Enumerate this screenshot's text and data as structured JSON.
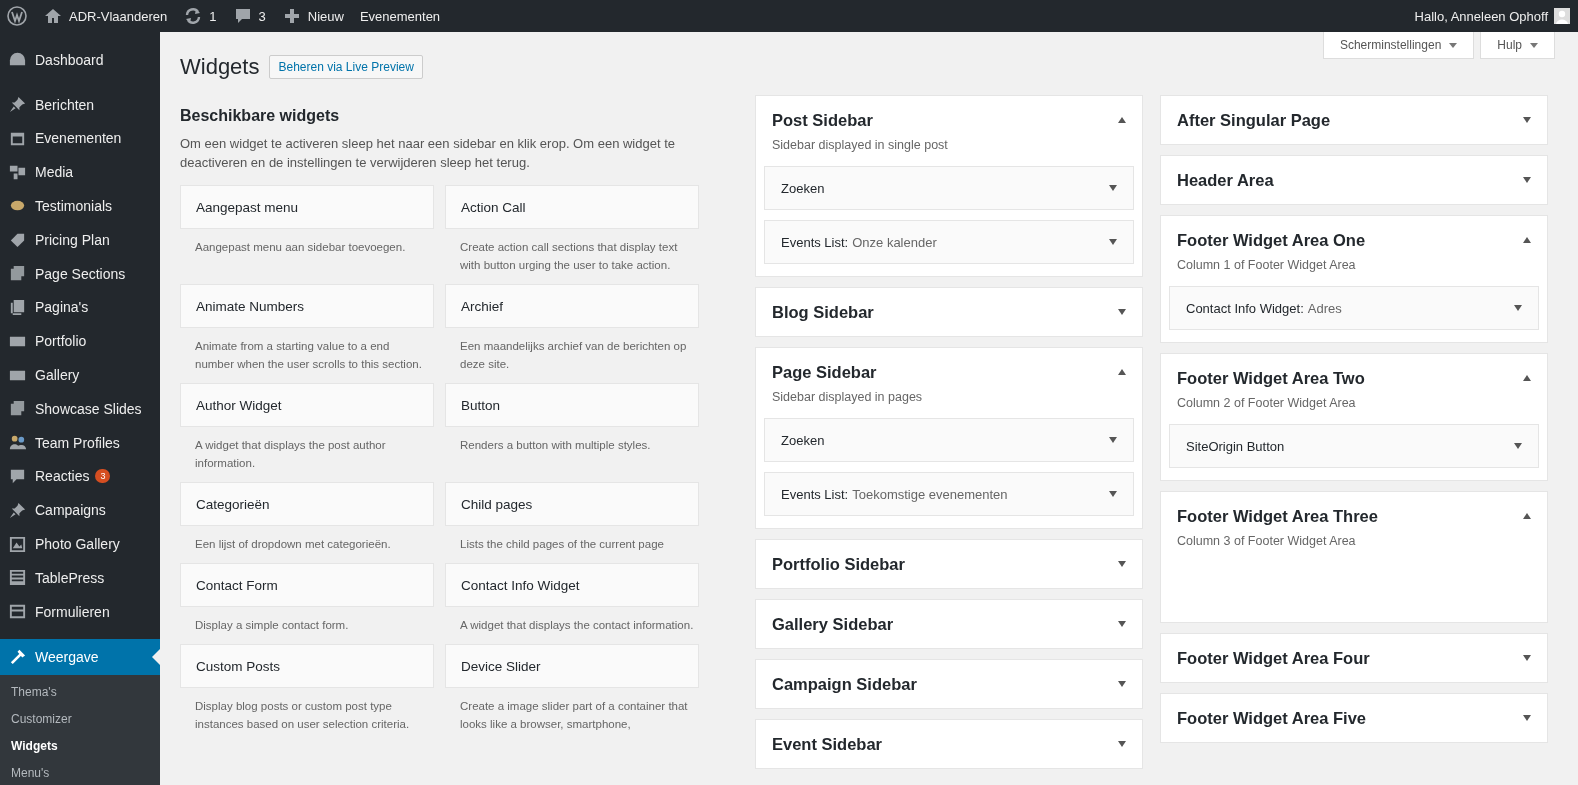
{
  "admin_bar": {
    "site": "ADR-Vlaanderen",
    "updates": "1",
    "comments": "3",
    "new": "Nieuw",
    "extra": "Evenementen",
    "greeting": "Hallo, Anneleen Ophoff"
  },
  "menu": [
    {
      "label": "Dashboard",
      "selected": false
    },
    {
      "label": "Berichten",
      "selected": false
    },
    {
      "label": "Evenementen",
      "selected": false
    },
    {
      "label": "Media",
      "selected": false
    },
    {
      "label": "Testimonials",
      "selected": false
    },
    {
      "label": "Pricing Plan",
      "selected": false
    },
    {
      "label": "Page Sections",
      "selected": false
    },
    {
      "label": "Pagina's",
      "selected": false
    },
    {
      "label": "Portfolio",
      "selected": false
    },
    {
      "label": "Gallery",
      "selected": false
    },
    {
      "label": "Showcase Slides",
      "selected": false
    },
    {
      "label": "Team Profiles",
      "selected": false
    },
    {
      "label": "Reacties",
      "selected": false,
      "badge": "3"
    },
    {
      "label": "Campaigns",
      "selected": false
    },
    {
      "label": "Photo Gallery",
      "selected": false
    },
    {
      "label": "TablePress",
      "selected": false
    },
    {
      "label": "Formulieren",
      "selected": false
    },
    {
      "label": "Weergave",
      "selected": true,
      "children": [
        {
          "label": "Thema's",
          "selected": false
        },
        {
          "label": "Customizer",
          "selected": false
        },
        {
          "label": "Widgets",
          "selected": true
        },
        {
          "label": "Menu's",
          "selected": false
        }
      ]
    }
  ],
  "screen_tabs": [
    "Scherminstellingen",
    "Hulp"
  ],
  "page": {
    "title": "Widgets",
    "action": "Beheren via Live Preview"
  },
  "available": {
    "heading": "Beschikbare widgets",
    "intro": "Om een widget te activeren sleep het naar een sidebar en klik erop. Om een widget te deactiveren en de instellingen te verwijderen sleep het terug.",
    "widgets": [
      {
        "title": "Aangepast menu",
        "description": "Aangepast menu aan sidebar toevoegen."
      },
      {
        "title": "Action Call",
        "description": "Create action call sections that display text with button urging the user to take action."
      },
      {
        "title": "Animate Numbers",
        "description": "Animate from a starting value to a end number when the user scrolls to this section."
      },
      {
        "title": "Archief",
        "description": "Een maandelijks archief van de berichten op deze site."
      },
      {
        "title": "Author Widget",
        "description": "A widget that displays the post author information."
      },
      {
        "title": "Button",
        "description": "Renders a button with multiple styles."
      },
      {
        "title": "Categorieën",
        "description": "Een lijst of dropdown met categorieën."
      },
      {
        "title": "Child pages",
        "description": "Lists the child pages of the current page"
      },
      {
        "title": "Contact Form",
        "description": "Display a simple contact form."
      },
      {
        "title": "Contact Info Widget",
        "description": "A widget that displays the contact information."
      },
      {
        "title": "Custom Posts",
        "description": "Display blog posts or custom post type instances based on user selection criteria."
      },
      {
        "title": "Device Slider",
        "description": "Create a image slider part of a container that looks like a browser, smartphone,"
      }
    ]
  },
  "sidebar_columns": [
    [
      {
        "title": "Post Sidebar",
        "expanded": true,
        "description": "Sidebar displayed in single post",
        "widgets": [
          {
            "title": "Zoeken"
          },
          {
            "title": "Events List:",
            "subtitle": "Onze kalender"
          }
        ]
      },
      {
        "title": "Blog Sidebar",
        "expanded": false
      },
      {
        "title": "Page Sidebar",
        "expanded": true,
        "description": "Sidebar displayed in pages",
        "widgets": [
          {
            "title": "Zoeken"
          },
          {
            "title": "Events List:",
            "subtitle": "Toekomstige evenementen"
          }
        ]
      },
      {
        "title": "Portfolio Sidebar",
        "expanded": false
      },
      {
        "title": "Gallery Sidebar",
        "expanded": false
      },
      {
        "title": "Campaign Sidebar",
        "expanded": false
      },
      {
        "title": "Event Sidebar",
        "expanded": false
      }
    ],
    [
      {
        "title": "After Singular Page",
        "expanded": false
      },
      {
        "title": "Header Area",
        "expanded": false
      },
      {
        "title": "Footer Widget Area One",
        "expanded": true,
        "description": "Column 1 of Footer Widget Area",
        "widgets": [
          {
            "title": "Contact Info Widget:",
            "subtitle": "Adres"
          }
        ]
      },
      {
        "title": "Footer Widget Area Two",
        "expanded": true,
        "description": "Column 2 of Footer Widget Area",
        "widgets": [
          {
            "title": "SiteOrigin Button"
          }
        ]
      },
      {
        "title": "Footer Widget Area Three",
        "expanded": true,
        "description": "Column 3 of Footer Widget Area"
      },
      {
        "title": "Footer Widget Area Four",
        "expanded": false
      },
      {
        "title": "Footer Widget Area Five",
        "expanded": false
      }
    ]
  ]
}
